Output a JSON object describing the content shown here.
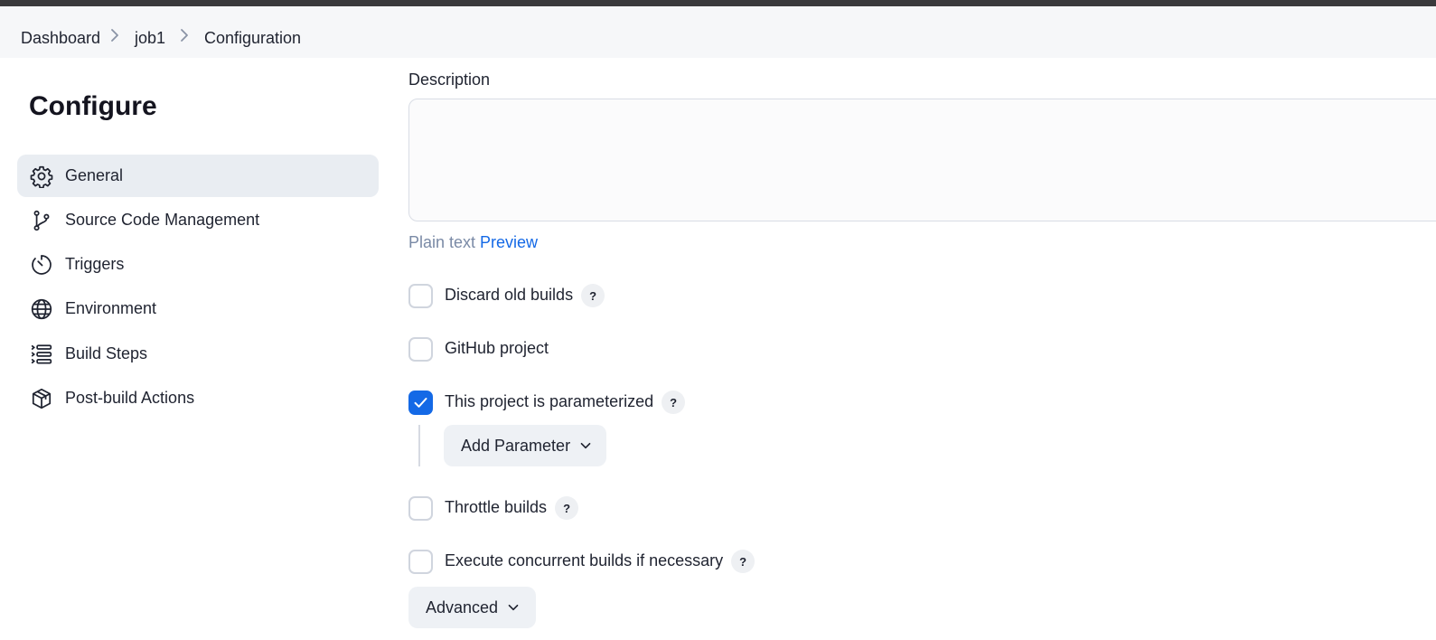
{
  "breadcrumb": {
    "items": [
      {
        "label": "Dashboard"
      },
      {
        "label": "job1"
      },
      {
        "label": "Configuration"
      }
    ]
  },
  "page": {
    "title": "Configure"
  },
  "sidebar": {
    "items": [
      {
        "label": "General",
        "icon": "gear-icon",
        "active": true
      },
      {
        "label": "Source Code Management",
        "icon": "git-branch-icon",
        "active": false
      },
      {
        "label": "Triggers",
        "icon": "timer-icon",
        "active": false
      },
      {
        "label": "Environment",
        "icon": "globe-icon",
        "active": false
      },
      {
        "label": "Build Steps",
        "icon": "list-steps-icon",
        "active": false
      },
      {
        "label": "Post-build Actions",
        "icon": "package-icon",
        "active": false
      }
    ]
  },
  "description": {
    "label": "Description",
    "value": "",
    "placeholder": "",
    "plain_text_label": "Plain text",
    "preview_label": "Preview"
  },
  "options": [
    {
      "label": "Discard old builds",
      "checked": false,
      "help": "?"
    },
    {
      "label": "GitHub project",
      "checked": false
    },
    {
      "label": "This project is parameterized",
      "checked": true,
      "help": "?"
    },
    {
      "label": "Throttle builds",
      "checked": false,
      "help": "?"
    },
    {
      "label": "Execute concurrent builds if necessary",
      "checked": false,
      "help": "?"
    }
  ],
  "buttons": {
    "add_parameter": "Add Parameter",
    "advanced": "Advanced"
  },
  "colors": {
    "accent": "#1469e6",
    "active_nav_bg": "#e9edf2",
    "breadcrumb_bg": "#f6f7f9",
    "topbar": "#3a3a3c"
  }
}
